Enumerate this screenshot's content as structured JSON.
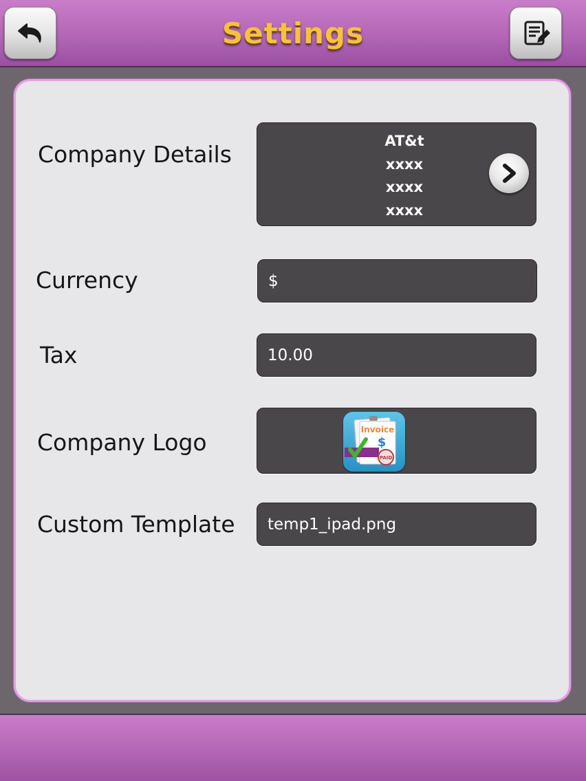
{
  "header": {
    "title": "Settings",
    "back_icon": "undo-arrow-icon",
    "edit_icon": "notepad-pencil-icon"
  },
  "settings": {
    "company_details": {
      "label": "Company Details",
      "lines": [
        "AT&t",
        "xxxx",
        "xxxx",
        "xxxx"
      ],
      "action_icon": "chevron-right-icon"
    },
    "currency": {
      "label": "Currency",
      "value": "$"
    },
    "tax": {
      "label": "Tax",
      "value": "10.00"
    },
    "company_logo": {
      "label": "Company Logo",
      "logo_text": "Invoice",
      "stamp_text": "PAID",
      "symbol": "$"
    },
    "custom_template": {
      "label": "Custom Template",
      "value": "temp1_ipad.png"
    }
  },
  "colors": {
    "header": "#b266b5",
    "title": "#f5c23a",
    "panel": "#e7e6e9",
    "field": "#4a474a",
    "panel_border": "#e79fe6"
  }
}
